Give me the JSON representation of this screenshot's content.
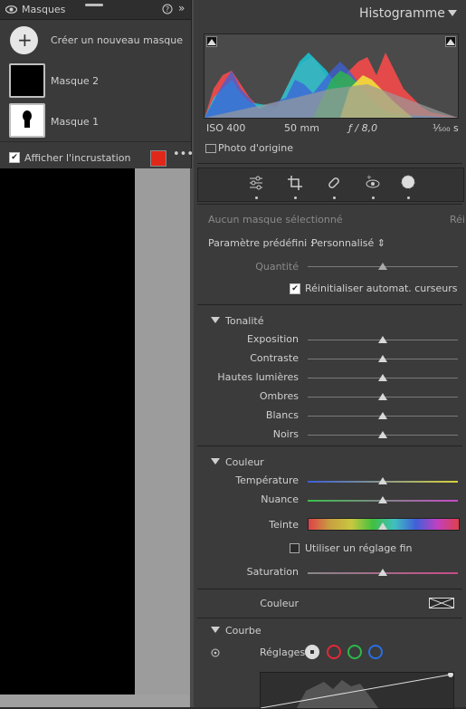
{
  "masks_panel": {
    "title": "Masques",
    "create_label": "Créer un nouveau masque",
    "masks": [
      {
        "label": "Masque 2"
      },
      {
        "label": "Masque 1"
      }
    ],
    "overlay_label": "Afficher l'incrustation",
    "overlay_color": "#e0281a"
  },
  "histogram": {
    "title": "Histogramme",
    "iso": "ISO 400",
    "focal": "50 mm",
    "aperture": "ƒ / 8,0",
    "shutter": "⅟₅₀₀ s",
    "original_photo_label": "Photo d'origine"
  },
  "tools": [
    "sliders-icon",
    "crop-icon",
    "healing-icon",
    "redeye-icon",
    "mask-icon"
  ],
  "mask_settings": {
    "status": "Aucun masque sélectionné",
    "reset_short": "Réi",
    "preset_label": "Paramètre prédéfini :",
    "preset_value": "Personnalisé ⇕",
    "amount_label": "Quantité",
    "auto_reset_label": "Réinitialiser automat. curseurs"
  },
  "tone": {
    "title": "Tonalité",
    "sliders": [
      {
        "label": "Exposition",
        "value": 0.5
      },
      {
        "label": "Contraste",
        "value": 0.5
      },
      {
        "label": "Hautes lumières",
        "value": 0.5
      },
      {
        "label": "Ombres",
        "value": 0.5
      },
      {
        "label": "Blancs",
        "value": 0.5
      },
      {
        "label": "Noirs",
        "value": 0.5
      }
    ]
  },
  "color": {
    "title": "Couleur",
    "temperature_label": "Température",
    "tint_label": "Nuance",
    "hue_label": "Teinte",
    "fine_label": "Utiliser un réglage fin",
    "saturation_label": "Saturation",
    "color_label": "Couleur"
  },
  "curve": {
    "title": "Courbe",
    "settings_label": "Réglages",
    "channels": [
      "white",
      "red",
      "green",
      "blue"
    ]
  }
}
